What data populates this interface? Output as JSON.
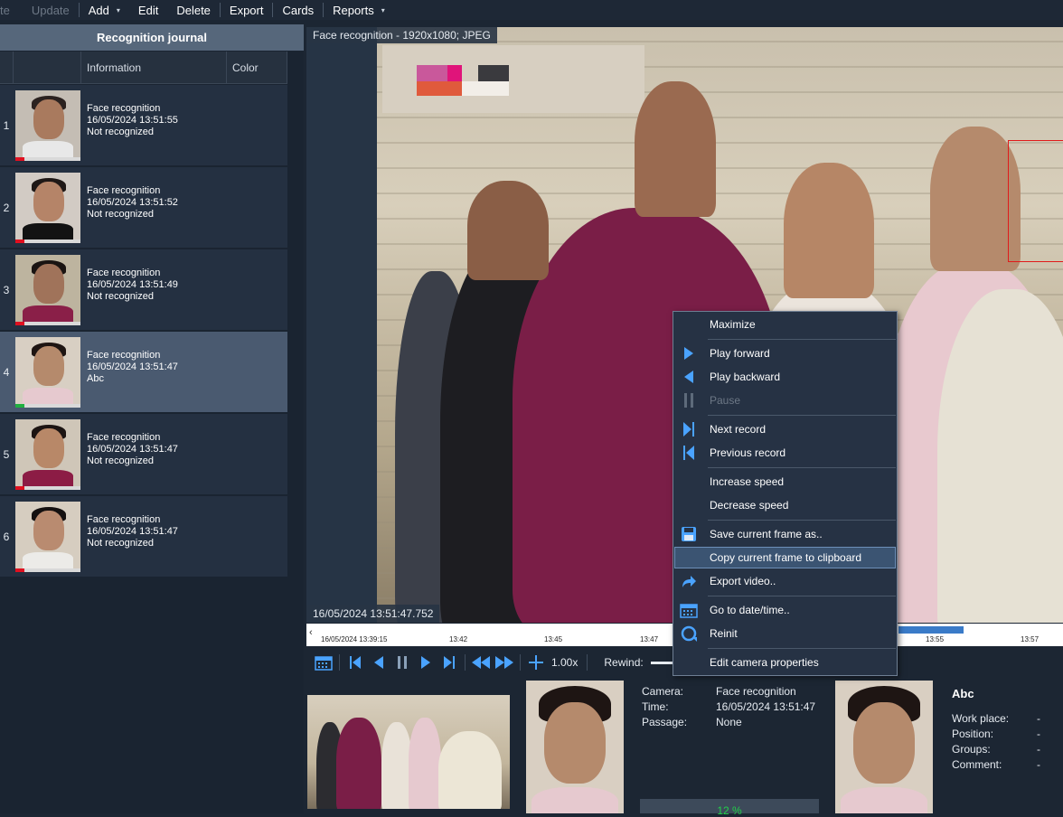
{
  "toolbar": {
    "items": [
      {
        "label": "te",
        "disabled": true
      },
      {
        "label": "Update",
        "disabled": true
      },
      {
        "label": "Add",
        "dropdown": true
      },
      {
        "label": "Edit"
      },
      {
        "label": "Delete"
      },
      {
        "label": "Export"
      },
      {
        "label": "Cards"
      },
      {
        "label": "Reports",
        "dropdown": true
      }
    ],
    "caret": "▾"
  },
  "journal": {
    "title": "Recognition journal",
    "columns": {
      "information": "Information",
      "color": "Color"
    },
    "rows": [
      {
        "num": "1",
        "line1": "Face recognition",
        "line2": "16/05/2024 13:51:55",
        "line3": "Not recognized",
        "status": "red"
      },
      {
        "num": "2",
        "line1": "Face recognition",
        "line2": "16/05/2024 13:51:52",
        "line3": "Not recognized",
        "status": "red"
      },
      {
        "num": "3",
        "line1": "Face recognition",
        "line2": "16/05/2024 13:51:49",
        "line3": "Not recognized",
        "status": "red"
      },
      {
        "num": "4",
        "line1": "Face recognition",
        "line2": "16/05/2024 13:51:47",
        "line3": "Abc",
        "status": "green",
        "selected": true
      },
      {
        "num": "5",
        "line1": "Face recognition",
        "line2": "16/05/2024 13:51:47",
        "line3": "Not recognized",
        "status": "red"
      },
      {
        "num": "6",
        "line1": "Face recognition",
        "line2": "16/05/2024 13:51:47",
        "line3": "Not recognized",
        "status": "red"
      }
    ]
  },
  "video": {
    "caption": "Face recognition - 1920x1080; JPEG",
    "timestamp": "16/05/2024 13:51:47.752"
  },
  "timeline": {
    "arrow": "‹",
    "labels": [
      "16/05/2024 13:39:15",
      "13:42",
      "13:45",
      "13:47",
      "13:55",
      "13:57"
    ]
  },
  "controls": {
    "speed": "1.00x",
    "rewind_label": "Rewind:"
  },
  "bottom": {
    "event": {
      "camera_key": "Camera:",
      "camera_val": "Face recognition",
      "time_key": "Time:",
      "time_val": "16/05/2024 13:51:47",
      "passage_key": "Passage:",
      "passage_val": "None",
      "progress": "12 %"
    },
    "person": {
      "name": "Abc",
      "workplace_key": "Work place:",
      "workplace_val": "-",
      "position_key": "Position:",
      "position_val": "-",
      "groups_key": "Groups:",
      "groups_val": "-",
      "comment_key": "Comment:",
      "comment_val": "-"
    }
  },
  "context_menu": {
    "items": [
      {
        "label": "Maximize",
        "icon": "none"
      },
      {
        "label": "Play forward",
        "icon": "play-forward-icon"
      },
      {
        "label": "Play backward",
        "icon": "play-backward-icon"
      },
      {
        "label": "Pause",
        "icon": "pause-icon",
        "disabled": true
      },
      {
        "label": "Next record",
        "icon": "next-record-icon"
      },
      {
        "label": "Previous record",
        "icon": "previous-record-icon"
      },
      {
        "label": "Increase speed",
        "icon": "none"
      },
      {
        "label": "Decrease speed",
        "icon": "none"
      },
      {
        "label": "Save current frame as..",
        "icon": "save-icon"
      },
      {
        "label": "Copy current frame to clipboard",
        "icon": "none",
        "hover": true
      },
      {
        "label": "Export video..",
        "icon": "export-arrow-icon"
      },
      {
        "label": "Go to date/time..",
        "icon": "calendar-icon"
      },
      {
        "label": "Reinit",
        "icon": "reinit-icon"
      },
      {
        "label": "Edit camera properties",
        "icon": "none"
      }
    ]
  }
}
